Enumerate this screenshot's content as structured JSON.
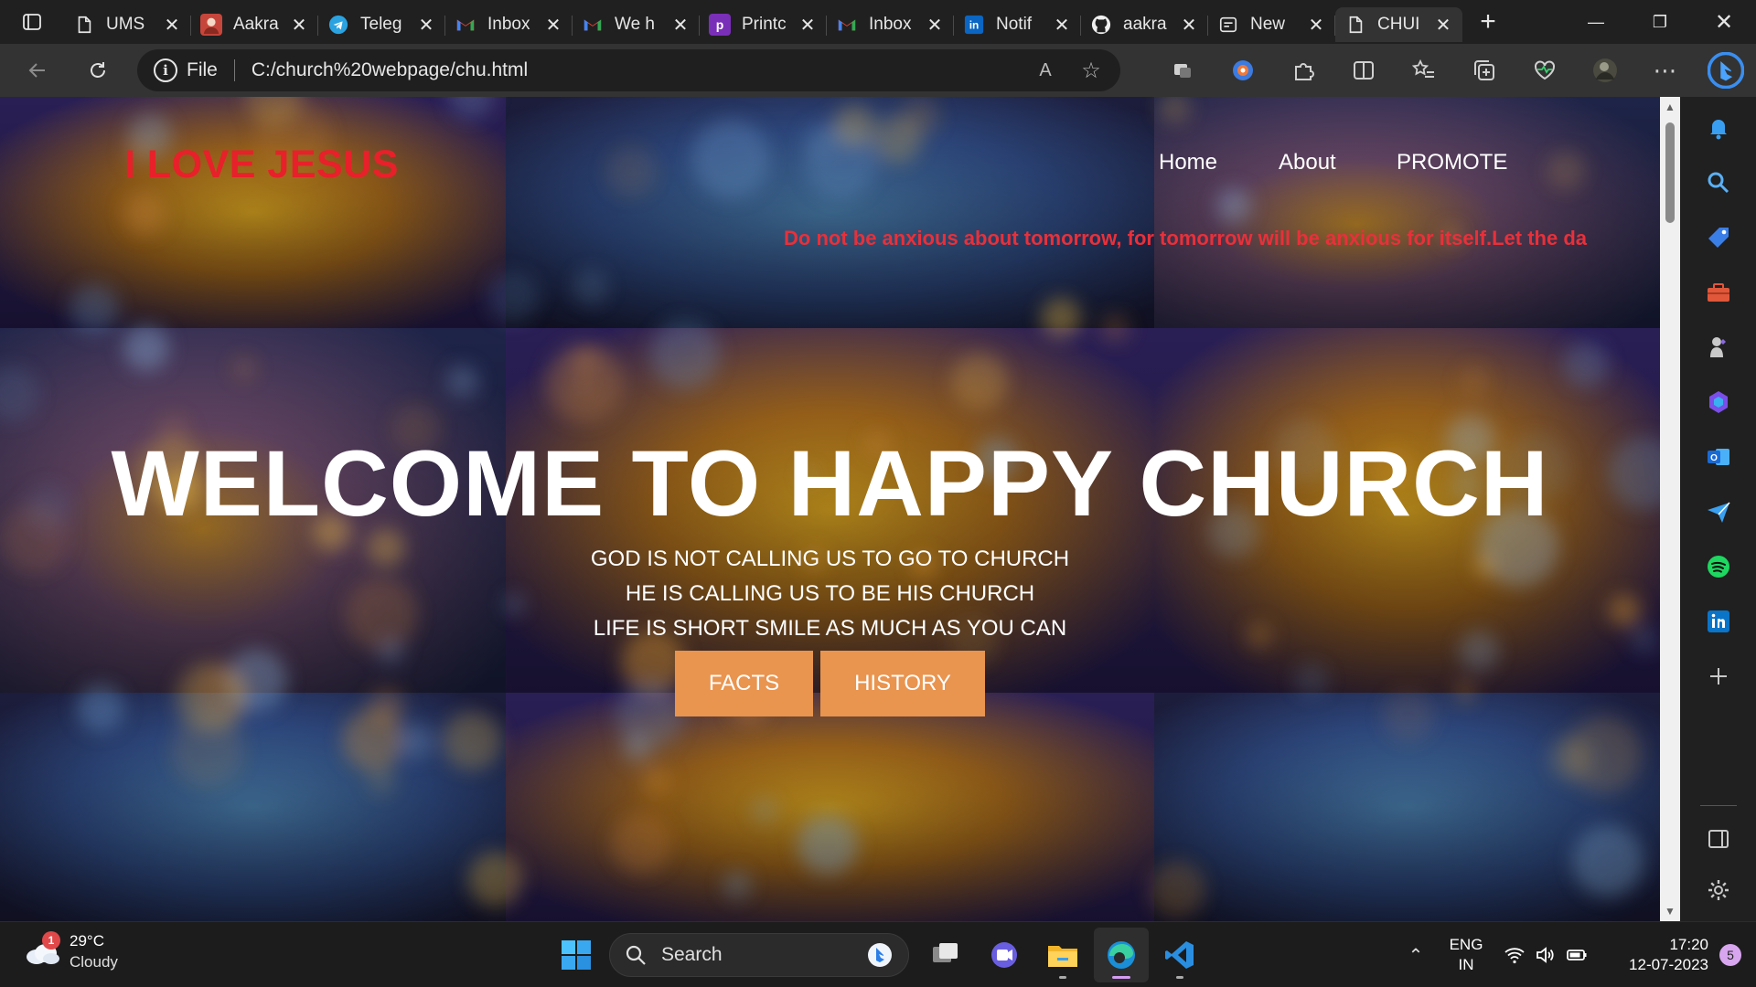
{
  "browser": {
    "tabs": [
      {
        "title": "UMS",
        "icon": "page-icon"
      },
      {
        "title": "Aakra",
        "icon": "avatar-favicon"
      },
      {
        "title": "Teleg",
        "icon": "telegram-icon"
      },
      {
        "title": "Inbox",
        "icon": "gmail-icon"
      },
      {
        "title": "We h",
        "icon": "gmail-icon"
      },
      {
        "title": "Printc",
        "icon": "p-icon"
      },
      {
        "title": "Inbox",
        "icon": "gmail-icon"
      },
      {
        "title": "Notif",
        "icon": "linkedin-icon"
      },
      {
        "title": "aakra",
        "icon": "github-icon"
      },
      {
        "title": "New",
        "icon": "newtab-icon"
      },
      {
        "title": "CHUI",
        "icon": "page-icon"
      }
    ],
    "active_tab_index": 10,
    "address": {
      "scheme_label": "File",
      "url": "C:/church%20webpage/chu.html"
    }
  },
  "site": {
    "logo": "I LOVE JESUS",
    "nav": [
      {
        "label": "Home"
      },
      {
        "label": "About"
      },
      {
        "label": "PROMOTE"
      }
    ],
    "marquee": "Do not be anxious about tomorrow, for tomorrow will be anxious for itself.Let the da",
    "hero_title": "WELCOME TO HAPPY CHURCH",
    "subtitles": [
      "GOD IS NOT CALLING US TO GO TO CHURCH",
      "HE IS CALLING US TO BE HIS CHURCH",
      "LIFE IS SHORT SMILE AS MUCH AS YOU CAN"
    ],
    "buttons": [
      {
        "label": "FACTS"
      },
      {
        "label": "HISTORY"
      }
    ],
    "colors": {
      "logo": "#e8202a",
      "marquee": "#e8303a",
      "button": "#e9944f"
    }
  },
  "taskbar": {
    "weather": {
      "badge": "1",
      "temp": "29°C",
      "condition": "Cloudy"
    },
    "search_placeholder": "Search",
    "lang": {
      "line1": "ENG",
      "line2": "IN"
    },
    "clock": {
      "time": "17:20",
      "date": "12-07-2023"
    },
    "notification_count": "5"
  }
}
